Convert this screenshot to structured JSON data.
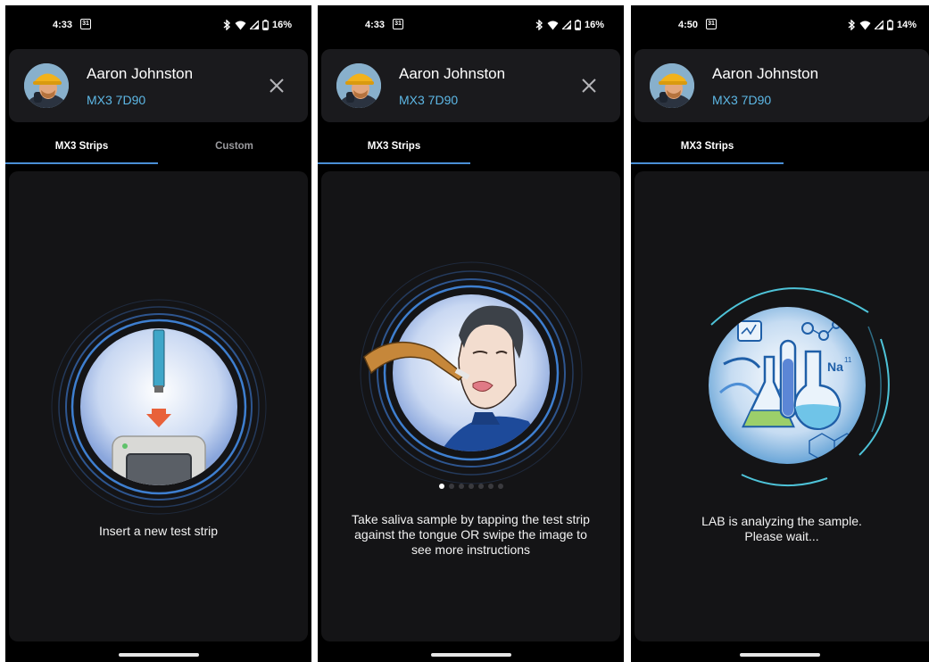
{
  "screens": [
    {
      "status": {
        "time": "4:33",
        "calendar": "31",
        "battery": "16%"
      },
      "user": {
        "name": "Aaron Johnston",
        "device": "MX3 7D90"
      },
      "tabs": [
        {
          "label": "MX3 Strips",
          "active": true
        },
        {
          "label": "Custom",
          "active": false
        }
      ],
      "illustration": "insert-strip-illustration",
      "instruction": "Insert a new test strip"
    },
    {
      "status": {
        "time": "4:33",
        "calendar": "31",
        "battery": "16%"
      },
      "user": {
        "name": "Aaron Johnston",
        "device": "MX3 7D90"
      },
      "tabs": [
        {
          "label": "MX3 Strips",
          "active": true
        }
      ],
      "illustration": "saliva-sample-illustration",
      "pager": {
        "count": 7,
        "active_index": 0
      },
      "instruction": "Take saliva sample by tapping the test strip against the tongue OR swipe the image to see more instructions"
    },
    {
      "status": {
        "time": "4:50",
        "calendar": "31",
        "battery": "14%"
      },
      "user": {
        "name": "Aaron Johnston",
        "device": "MX3 7D90"
      },
      "tabs": [
        {
          "label": "MX3 Strips",
          "active": true
        }
      ],
      "illustration": "lab-analyzing-illustration",
      "instruction_line1": "LAB is analyzing the sample.",
      "instruction_line2": "Please wait...",
      "lab_glyphs": {
        "element": "Na",
        "superscript": "11"
      }
    }
  ],
  "icons": {
    "bluetooth": "bluetooth-icon",
    "wifi": "wifi-icon",
    "signal": "cell-signal-icon",
    "battery": "battery-icon",
    "close": "close-icon",
    "calendar": "calendar-icon"
  },
  "colors": {
    "accent_blue": "#4a8fd6",
    "device_text": "#5db8e6",
    "card_bg": "#1a1a1d",
    "content_bg": "#141416",
    "arrow_orange": "#e8613a",
    "ring_blue": "#3e7fd0",
    "ring_teal": "#4ec3d8"
  }
}
